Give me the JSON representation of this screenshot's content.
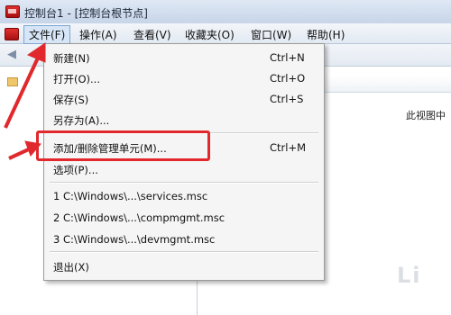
{
  "window": {
    "title": "控制台1 - [控制台根节点]"
  },
  "menubar": {
    "items": [
      "文件(F)",
      "操作(A)",
      "查看(V)",
      "收藏夹(O)",
      "窗口(W)",
      "帮助(H)"
    ]
  },
  "right_pane": {
    "text": "此视图中"
  },
  "file_menu": {
    "items": [
      {
        "label": "新建(N)",
        "shortcut": "Ctrl+N"
      },
      {
        "label": "打开(O)...",
        "shortcut": "Ctrl+O"
      },
      {
        "label": "保存(S)",
        "shortcut": "Ctrl+S"
      },
      {
        "label": "另存为(A)...",
        "shortcut": ""
      },
      {
        "label": "添加/删除管理单元(M)...",
        "shortcut": "Ctrl+M"
      },
      {
        "label": "选项(P)...",
        "shortcut": ""
      },
      {
        "label": "1 C:\\Windows\\...\\services.msc",
        "shortcut": ""
      },
      {
        "label": "2 C:\\Windows\\...\\compmgmt.msc",
        "shortcut": ""
      },
      {
        "label": "3 C:\\Windows\\...\\devmgmt.msc",
        "shortcut": ""
      },
      {
        "label": "退出(X)",
        "shortcut": ""
      }
    ]
  },
  "annotation": {
    "color": "#e0282d"
  },
  "watermark": {
    "text": "Li"
  }
}
